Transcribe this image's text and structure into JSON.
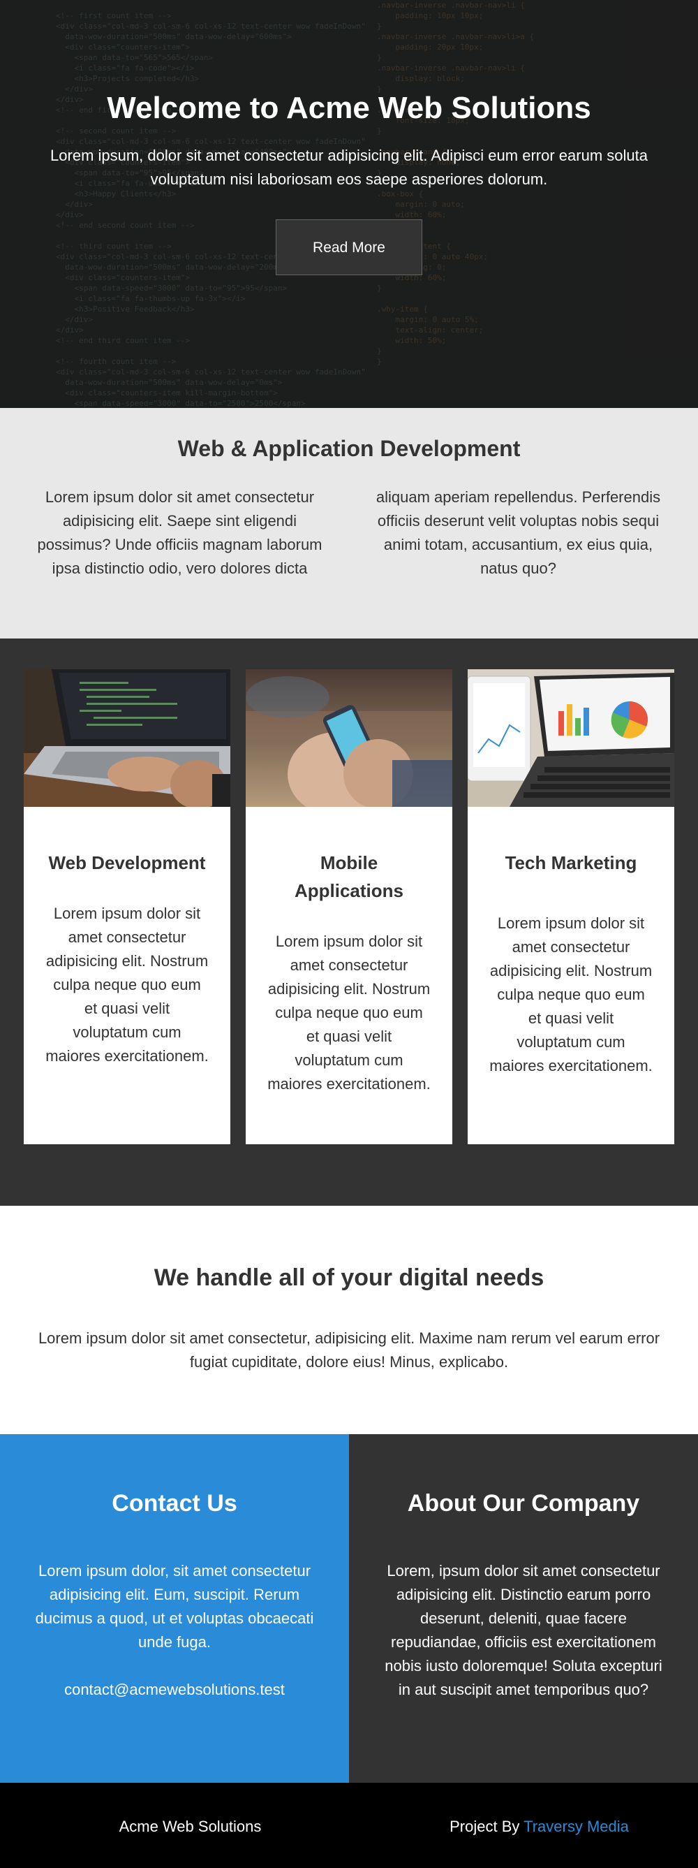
{
  "hero": {
    "title": "Welcome to Acme Web Solutions",
    "text": "Lorem ipsum, dolor sit amet consectetur adipisicing elit. Adipisci eum error earum soluta voluptatum nisi laboriosam eos saepe asperiores dolorum.",
    "button": "Read More"
  },
  "dev": {
    "title": "Web & Application Development",
    "col1": "Lorem ipsum dolor sit amet consectetur adipisicing elit. Saepe sint eligendi possimus? Unde officiis magnam laborum ipsa distinctio odio, vero dolores dicta",
    "col2": "aliquam aperiam repellendus. Perferendis officiis deserunt velit voluptas nobis sequi animi totam, accusantium, ex eius quia, natus quo?"
  },
  "cards": [
    {
      "title": "Web Development",
      "text": "Lorem ipsum dolor sit amet consectetur adipisicing elit. Nostrum culpa neque quo eum et quasi velit voluptatum cum maiores exercitationem."
    },
    {
      "title": "Mobile Applications",
      "text": "Lorem ipsum dolor sit amet consectetur adipisicing elit. Nostrum culpa neque quo eum et quasi velit voluptatum cum maiores exercitationem."
    },
    {
      "title": "Tech Marketing",
      "text": "Lorem ipsum dolor sit amet consectetur adipisicing elit. Nostrum culpa neque quo eum et quasi velit voluptatum cum maiores exercitationem."
    }
  ],
  "digital": {
    "title": "We handle all of your digital needs",
    "text": "Lorem ipsum dolor sit amet consectetur, adipisicing elit. Maxime nam rerum vel earum error fugiat cupiditate, dolore eius! Minus, explicabo."
  },
  "contact": {
    "title": "Contact Us",
    "text": "Lorem ipsum dolor, sit amet consectetur adipisicing elit. Eum, suscipit. Rerum ducimus a quod, ut et voluptas obcaecati unde fuga.",
    "email": "contact@acmewebsolutions.test"
  },
  "about": {
    "title": "About Our Company",
    "text": "Lorem, ipsum dolor sit amet consectetur adipisicing elit. Distinctio earum porro deserunt, deleniti, quae facere repudiandae, officiis est exercitationem nobis iusto doloremque! Soluta excepturi in aut suscipit amet temporibus quo?"
  },
  "footer": {
    "brand": "Acme Web Solutions",
    "project_prefix": "Project By",
    "project_link": "Traversy Media"
  },
  "colors": {
    "accent": "#2a8bd8",
    "dark": "#333333",
    "light_gray": "#e8e8e8",
    "footer": "#000000"
  }
}
